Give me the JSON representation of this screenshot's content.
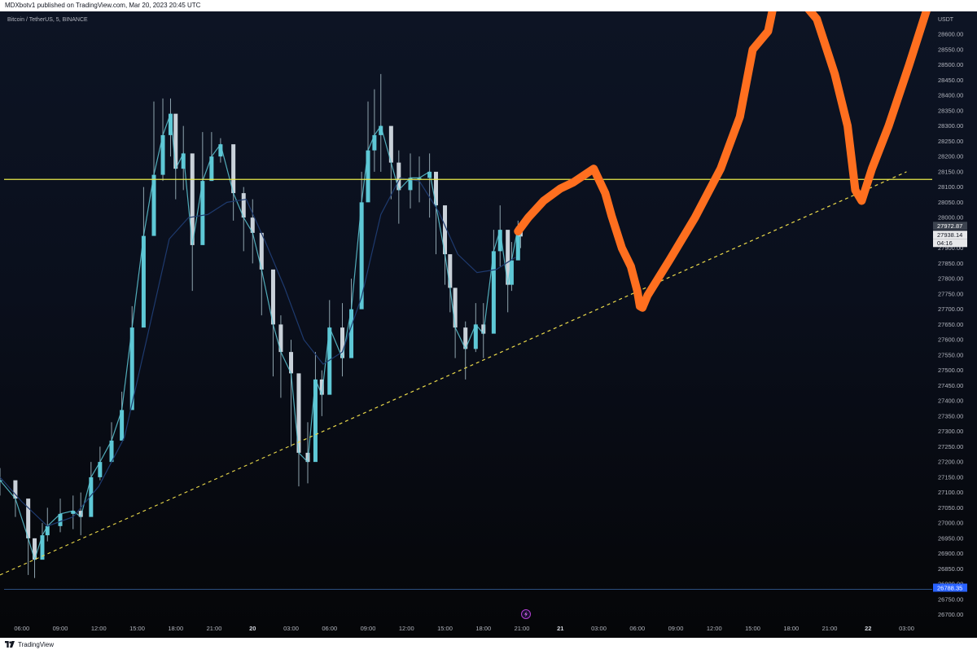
{
  "header": {
    "published": "MDXbotv1 published on TradingView.com, Mar 20, 2023 20:45 UTC"
  },
  "symbol_line": "Bitcoin / TetherUS, 5, BINANCE",
  "footer": {
    "brand": "TradingView"
  },
  "colors": {
    "candle": "#5ec8d6",
    "wick": "#8fa4ae",
    "ma": "#1e3a6e",
    "resistance": "#e9e84a",
    "trendline": "#e9d84a",
    "drawing": "#ff6f1f",
    "support": "#2b4f7e"
  },
  "icons": {
    "bolt": "lightning-bolt-icon",
    "logo": "tradingview-logo-icon"
  },
  "chart_data": {
    "type": "line",
    "title": "Bitcoin / TetherUS, 5, BINANCE",
    "y_unit": "USDT",
    "ylim": [
      26675,
      28675
    ],
    "y_ticks": [
      28600,
      28550,
      28500,
      28450,
      28400,
      28350,
      28300,
      28250,
      28200,
      28150,
      28100,
      28050,
      28000,
      27950,
      27900,
      27850,
      27800,
      27750,
      27700,
      27650,
      27600,
      27550,
      27500,
      27450,
      27400,
      27350,
      27300,
      27250,
      27200,
      27150,
      27100,
      27050,
      27000,
      26950,
      26900,
      26850,
      26800,
      26750,
      26700
    ],
    "y_tick_labels": [
      "28600.00",
      "28550.00",
      "28500.00",
      "28450.00",
      "28400.00",
      "28350.00",
      "28300.00",
      "28250.00",
      "28200.00",
      "28150.00",
      "28100.00",
      "28050.00",
      "28000.00",
      "27950.00",
      "27900.00",
      "27850.00",
      "27800.00",
      "27750.00",
      "27700.00",
      "27650.00",
      "27600.00",
      "27550.00",
      "27500.00",
      "27450.00",
      "27400.00",
      "27350.00",
      "27300.00",
      "27250.00",
      "27200.00",
      "27150.00",
      "27100.00",
      "27050.00",
      "27000.00",
      "26950.00",
      "26900.00",
      "26850.00",
      "26800.00",
      "26750.00",
      "26700.00"
    ],
    "x_ticks": [
      "06:00",
      "09:00",
      "12:00",
      "15:00",
      "18:00",
      "21:00",
      "20",
      "03:00",
      "06:00",
      "09:00",
      "12:00",
      "15:00",
      "18:00",
      "21:00",
      "21",
      "03:00",
      "06:00",
      "09:00",
      "12:00",
      "15:00",
      "18:00",
      "21:00",
      "22",
      "03:00"
    ],
    "x_tick_hours": [
      6,
      9,
      12,
      15,
      18,
      21,
      24,
      27,
      30,
      33,
      36,
      39,
      42,
      45,
      48,
      51,
      54,
      57,
      60,
      63,
      66,
      69,
      72,
      75
    ],
    "xlim_hours": [
      4.3,
      77
    ],
    "series": [
      {
        "kind": "price",
        "x_hours": [
          4.3,
          5.5,
          6.5,
          7.0,
          7.6,
          8.0,
          9.0,
          10.0,
          10.6,
          11.4,
          12.1,
          13.0,
          13.8,
          14.6,
          15.5,
          16.3,
          17.0,
          17.6,
          18.0,
          18.6,
          19.3,
          20.1,
          20.8,
          21.5,
          22.5,
          23.3,
          24.0,
          24.7,
          25.6,
          26.2,
          27.0,
          27.6,
          28.3,
          28.9,
          29.4,
          30.0,
          31.0,
          31.7,
          32.5,
          33.0,
          33.5,
          34.0,
          34.8,
          35.4,
          36.3,
          37.0,
          37.8,
          38.3,
          39.0,
          39.4,
          39.8,
          40.6,
          41.4,
          42.0,
          42.8,
          43.3,
          43.9,
          44.2,
          44.7,
          44.9
        ],
        "y": [
          27140,
          27080,
          26950,
          26880,
          26960,
          26990,
          27030,
          27040,
          27020,
          27150,
          27200,
          27270,
          27370,
          27640,
          27940,
          28140,
          28270,
          28340,
          28160,
          28210,
          27910,
          28120,
          28200,
          28240,
          28080,
          28000,
          27950,
          27830,
          27650,
          27560,
          27490,
          27230,
          27200,
          27470,
          27420,
          27640,
          27540,
          27700,
          28050,
          28220,
          28270,
          28300,
          28180,
          28090,
          28130,
          28130,
          28150,
          28040,
          27880,
          27770,
          27640,
          27570,
          27650,
          27620,
          27890,
          27960,
          27780,
          27860,
          27970,
          27938.14
        ],
        "y_high": [
          27180,
          27120,
          27000,
          26950,
          27000,
          27050,
          27080,
          27090,
          27100,
          27200,
          27250,
          27330,
          27430,
          27710,
          28100,
          28380,
          28390,
          28390,
          28260,
          28300,
          28100,
          28280,
          28280,
          28260,
          28210,
          28100,
          28060,
          27930,
          27800,
          27680,
          27600,
          27370,
          27330,
          27560,
          27500,
          27730,
          27720,
          27800,
          28150,
          28380,
          28420,
          28470,
          28250,
          28220,
          28210,
          28200,
          28210,
          28130,
          27970,
          27880,
          27770,
          27660,
          27720,
          27720,
          27960,
          28040,
          27880,
          27920,
          27990,
          27960
        ],
        "y_low": [
          27090,
          27020,
          26830,
          26820,
          26900,
          26940,
          26970,
          26980,
          26960,
          27080,
          27140,
          27200,
          27300,
          27590,
          27800,
          28000,
          28120,
          28200,
          28060,
          28090,
          27760,
          27950,
          28120,
          28180,
          27990,
          27890,
          27850,
          27680,
          27480,
          27410,
          27250,
          27120,
          27130,
          27360,
          27350,
          27510,
          27480,
          27570,
          27930,
          28120,
          28150,
          28150,
          28060,
          27980,
          28030,
          28050,
          28000,
          27880,
          27780,
          27690,
          27540,
          27470,
          27560,
          27540,
          27760,
          27840,
          27690,
          27760,
          27880,
          27900
        ]
      },
      {
        "kind": "moving-average",
        "x_hours": [
          4.3,
          6.0,
          8.0,
          10.0,
          12.0,
          14.0,
          16.0,
          17.5,
          19.0,
          20.5,
          22.0,
          23.5,
          25.0,
          26.5,
          28.0,
          29.5,
          31.0,
          32.5,
          34.0,
          35.5,
          37.0,
          38.5,
          40.0,
          41.5,
          43.0,
          44.5
        ],
        "y": [
          27150,
          27070,
          26990,
          27020,
          27120,
          27280,
          27650,
          27930,
          28000,
          28010,
          28050,
          28060,
          27920,
          27770,
          27600,
          27520,
          27560,
          27740,
          28010,
          28130,
          28120,
          28020,
          27880,
          27820,
          27830,
          27870
        ]
      },
      {
        "kind": "resistance",
        "y": 28125
      },
      {
        "kind": "trendline",
        "x_hours": [
          4.3,
          75.0
        ],
        "y": [
          26830,
          28150
        ]
      },
      {
        "kind": "support",
        "y": 26783
      },
      {
        "kind": "drawing",
        "x_hours": [
          44.7,
          45.5,
          46.7,
          48.0,
          49.0,
          50.6,
          51.5,
          52.0,
          52.8,
          53.5,
          54.0,
          54.2,
          54.4,
          54.8,
          56.5,
          58.5,
          60.5,
          62.0,
          63.0,
          64.2,
          65.0,
          66.2,
          68.0,
          69.4,
          70.4,
          71.0,
          71.5,
          72.3,
          73.6,
          75.2,
          76.8
        ],
        "y": [
          27955,
          28000,
          28055,
          28095,
          28115,
          28160,
          28080,
          28005,
          27900,
          27840,
          27760,
          27710,
          27705,
          27745,
          27860,
          28000,
          28160,
          28330,
          28550,
          28610,
          28770,
          28740,
          28650,
          28470,
          28300,
          28090,
          28055,
          28160,
          28300,
          28500,
          28710
        ]
      }
    ],
    "price_tags": [
      {
        "label": "27972.87",
        "y": 27972.87,
        "color": "#3d4450"
      },
      {
        "label": "27938.14",
        "y": 27938.14,
        "color": "#e7e8ea"
      },
      {
        "label": "04:16",
        "y": 27912,
        "color": "#e7e8ea"
      },
      {
        "label": "26788.35",
        "y": 26788.35,
        "color": "#2962ff"
      }
    ]
  }
}
